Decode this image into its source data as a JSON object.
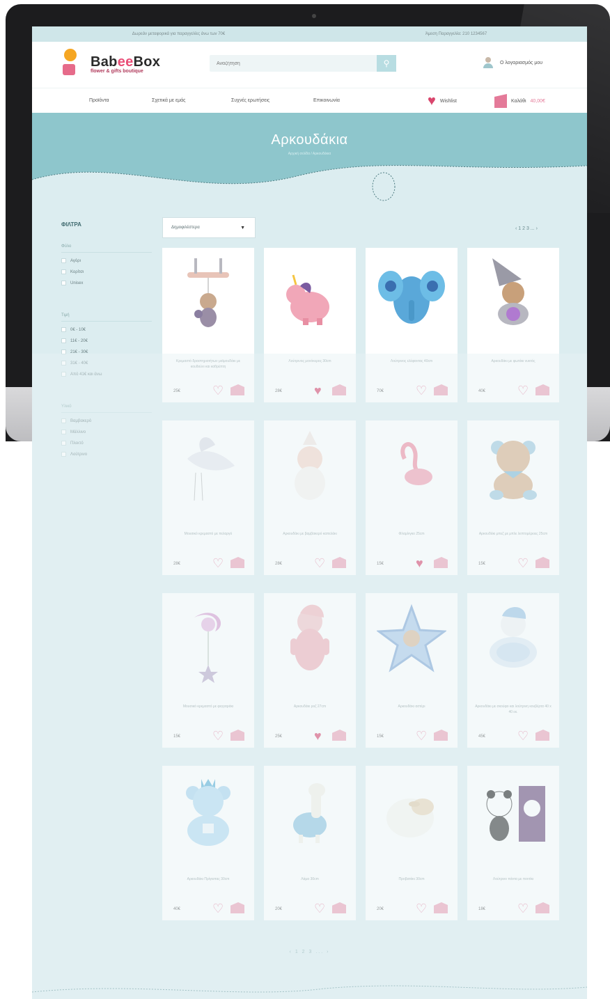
{
  "topbar": {
    "left": "Δωρεάν μεταφορικά για παραγγελίες άνω των 70€",
    "right": "Άμεση Παραγγελία: 210 1234567"
  },
  "brand": {
    "name_start": "Bab",
    "name_ee": "ee",
    "name_end": "Box",
    "tagline": "flower & gifts boutique"
  },
  "search": {
    "placeholder": "Αναζήτηση",
    "icon": "search-icon"
  },
  "account": {
    "label": "Ο λογαριασμός μου"
  },
  "nav": {
    "items": [
      "Προϊόντα",
      "Σχετικά με εμάς",
      "Συχνές ερωτήσεις",
      "Επικοινωνία"
    ],
    "wishlist": "Wishlist",
    "cart_label": "Καλάθι",
    "cart_total": "40,00€"
  },
  "hero": {
    "title": "Αρκουδάκια",
    "breadcrumb": "Αρχική σελίδα / Αρκουδάκια"
  },
  "filters": {
    "title": "ΦΙΛΤΡΑ",
    "groups": [
      {
        "heading": "Φύλο",
        "options": [
          "Αγόρι",
          "Κορίτσι",
          "Unisex"
        ]
      },
      {
        "heading": "Τιμή",
        "options": [
          "0€ - 10€",
          "11€ - 20€",
          "21€ - 30€",
          "31€ - 40€",
          "Από 41€ και άνω"
        ]
      },
      {
        "heading": "Υλικό",
        "options": [
          "Βαμβακερό",
          "Μάλλινο",
          "Πλεκτό",
          "Λούτρινο"
        ]
      }
    ]
  },
  "sort": {
    "selected": "Δημοφιλέστερα"
  },
  "pagination": {
    "top": "‹ 1  2  3 ... ›",
    "bottom": "‹ 1  2  3 ... ›"
  },
  "colors": {
    "accent": "#8ec6cc",
    "pink": "#e47a99",
    "heart_active": "#d9466d",
    "bg": "#dcedf0"
  },
  "products": [
    {
      "name": "Κρεμαστό δραστηριοτήτων μαϊμουδάκι με κουδούνι και καθρέπτη",
      "price": "25€",
      "liked": false,
      "image": "monkey-mobile"
    },
    {
      "name": "Λούτρινος μονόκερος 30cm",
      "price": "28€",
      "liked": true,
      "image": "unicorn"
    },
    {
      "name": "Λούτρινος ελέφαντας 40cm",
      "price": "70€",
      "liked": false,
      "image": "elephant"
    },
    {
      "name": "Αρκουδάκι με φωτάκι νυκτός",
      "price": "40€",
      "liked": false,
      "image": "night-light"
    },
    {
      "name": "Μουσικό κρεμαστό με πελαργό",
      "price": "28€",
      "liked": false,
      "image": "stork"
    },
    {
      "name": "Αρκουδάκι με βαμβακερό καπελάκι",
      "price": "28€",
      "liked": false,
      "image": "doll"
    },
    {
      "name": "Φλαμίνγκο 25cm",
      "price": "15€",
      "liked": true,
      "image": "flamingo"
    },
    {
      "name": "Αρκουδάκι μπεζ με μπλε λεπτομέρειες 25cm",
      "price": "15€",
      "liked": false,
      "image": "teddy"
    },
    {
      "name": "Μουσικό κρεμαστό με φεγγαράκι",
      "price": "15€",
      "liked": false,
      "image": "moon"
    },
    {
      "name": "Αρκουδάκι ροζ 27cm",
      "price": "25€",
      "liked": true,
      "image": "pink-bear"
    },
    {
      "name": "Αρκουδάκι αστέρι",
      "price": "15€",
      "liked": false,
      "image": "star"
    },
    {
      "name": "Αρκουδάκι με σκούφο και λούτρινη κουβέρτα 40 x 40 εκ.",
      "price": "45€",
      "liked": false,
      "image": "blanket-bear"
    },
    {
      "name": "Αρκουδάκι Πρίγκιπας 30cm",
      "price": "40€",
      "liked": false,
      "image": "prince-bear"
    },
    {
      "name": "Λάμα 30cm",
      "price": "20€",
      "liked": false,
      "image": "llama"
    },
    {
      "name": "Προβατάκι 30cm",
      "price": "20€",
      "liked": false,
      "image": "sheep"
    },
    {
      "name": "Λούτρινο πάντα με ποντίκι",
      "price": "18€",
      "liked": false,
      "image": "panda"
    }
  ]
}
